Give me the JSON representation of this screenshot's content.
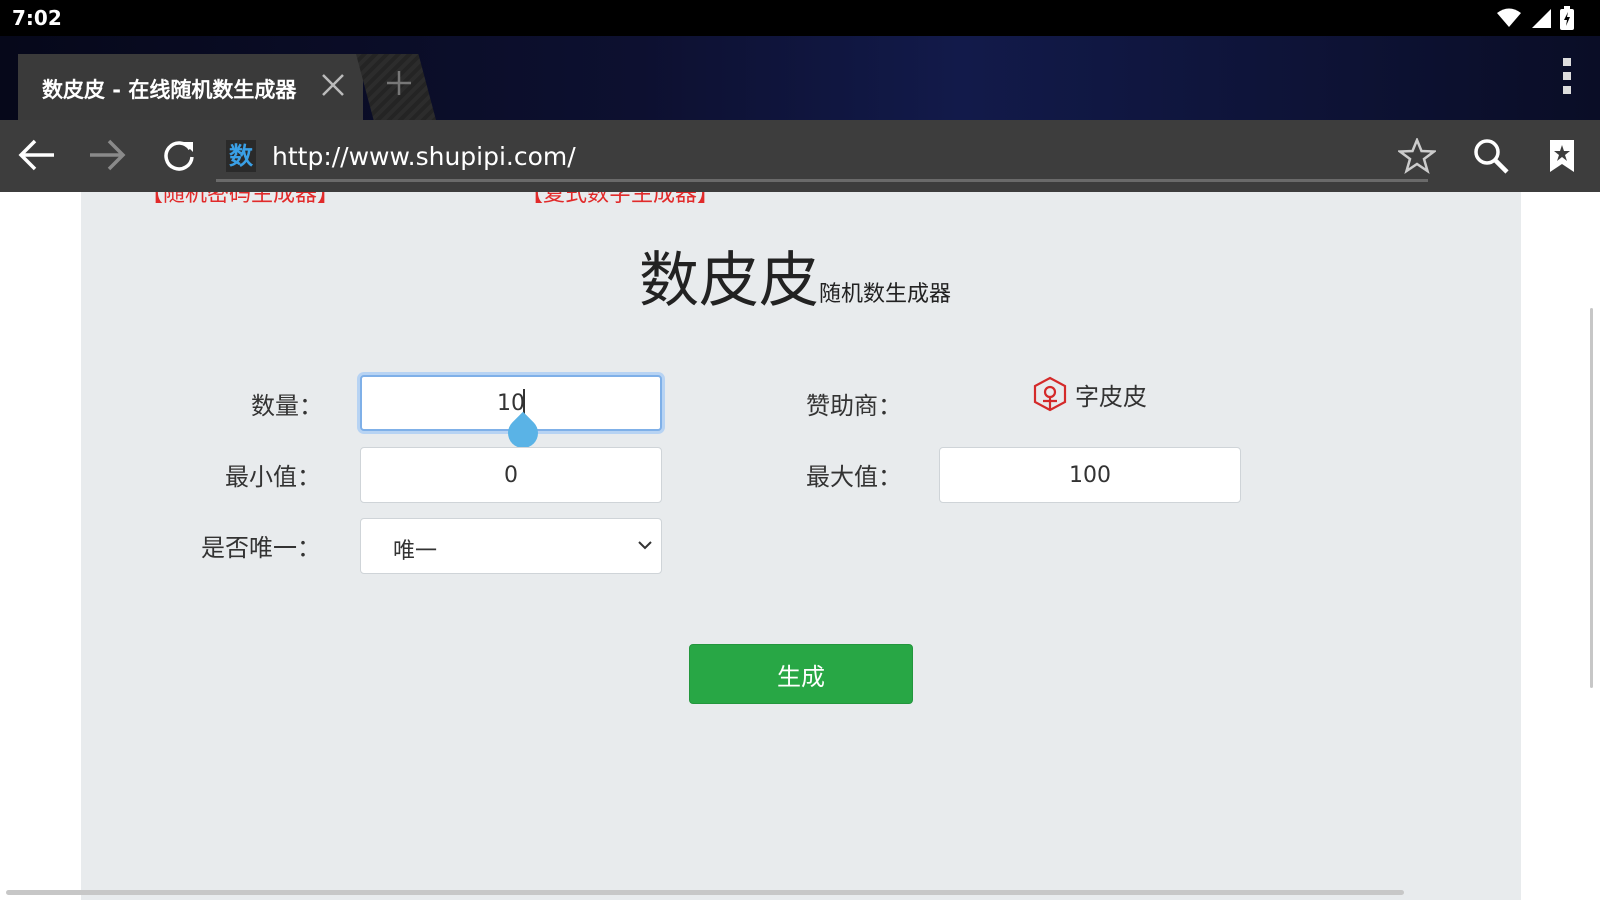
{
  "status_bar": {
    "time": "7:02",
    "icons": [
      "wifi-icon",
      "signal-icon",
      "battery-icon"
    ]
  },
  "browser": {
    "tab_title": "数皮皮 - 在线随机数生成器",
    "url": "http://www.shupipi.com/",
    "favicon_char": "数"
  },
  "page": {
    "cut_off_links": [
      "【随机密码生成器】",
      "【复式数字生成器】"
    ],
    "title_main": "数皮皮",
    "title_sub": "随机数生成器",
    "form": {
      "count_label": "数量：",
      "count_value": "10",
      "min_label": "最小值：",
      "min_value": "0",
      "unique_label": "是否唯一：",
      "unique_value": "唯一",
      "sponsor_label": "赞助商：",
      "sponsor_name": "字皮皮",
      "max_label": "最大值：",
      "max_value": "100"
    },
    "generate_button": "生成"
  },
  "colors": {
    "accent_green": "#28a745",
    "link_red": "#e12a2a",
    "panel_bg": "#e8ebed",
    "focus_blue": "#7fb0e8",
    "favicon_blue": "#3aa0e6"
  }
}
